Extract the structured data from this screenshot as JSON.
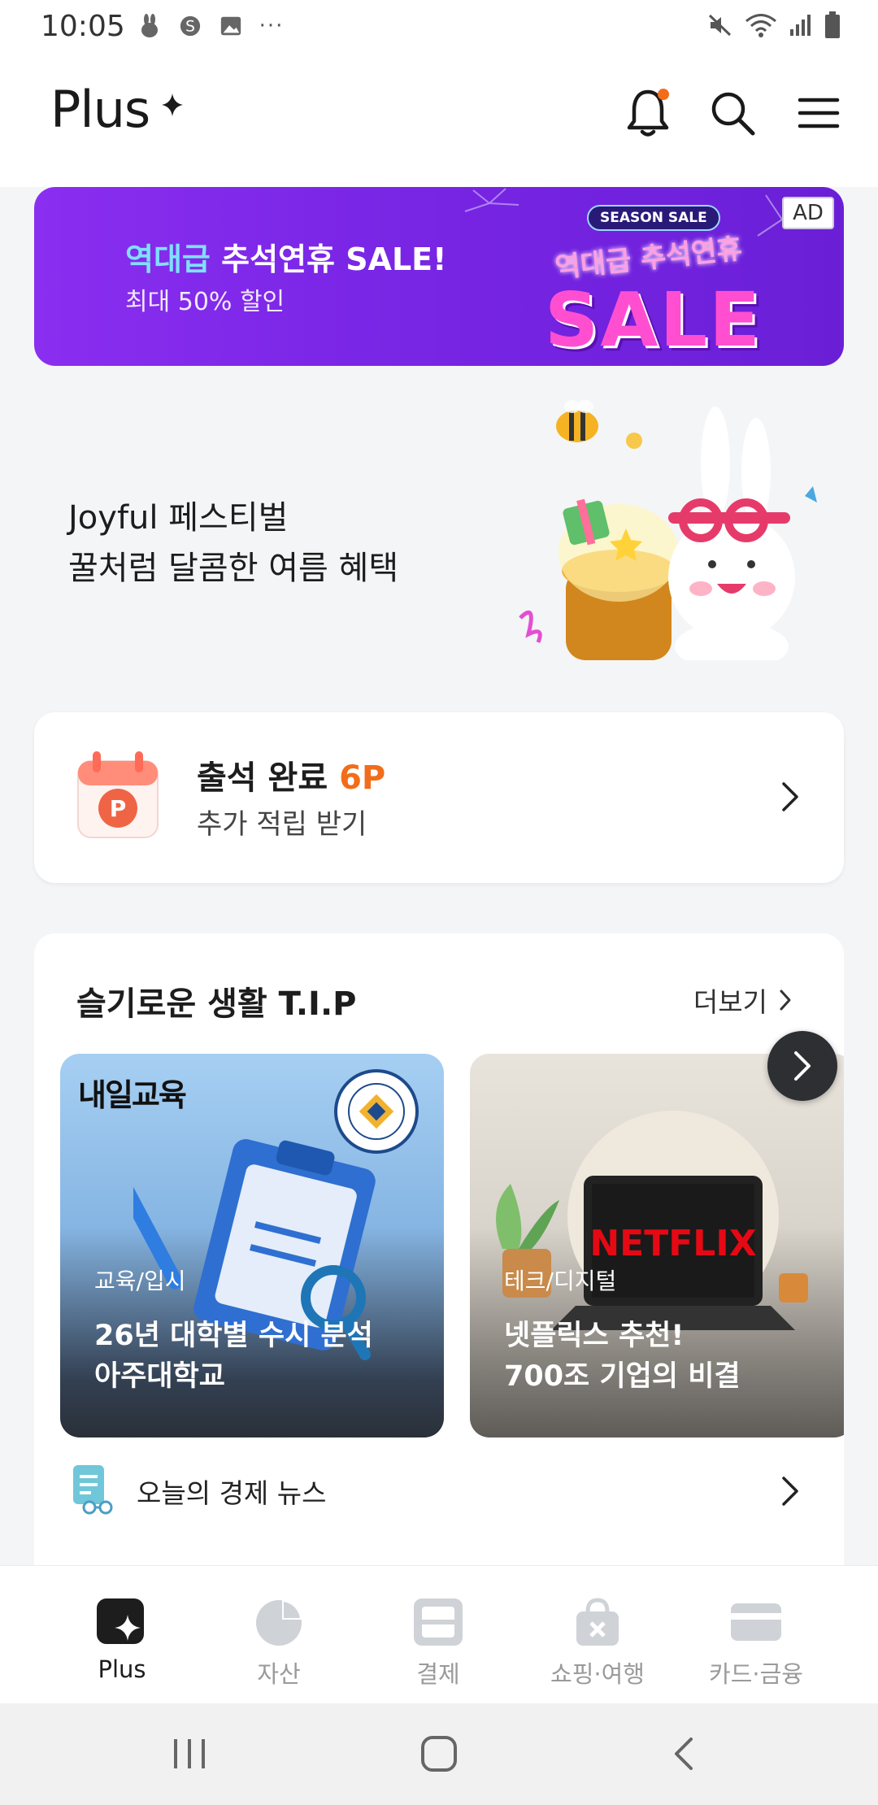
{
  "status_bar": {
    "time": "10:05",
    "left_icons": [
      "rabbit-icon",
      "s-icon",
      "image-icon",
      "more-dots-icon"
    ],
    "right_icons": [
      "mute-icon",
      "wifi-icon",
      "signal-icon",
      "battery-icon"
    ]
  },
  "header": {
    "logo": "Plus",
    "notification_dot_color": "#f26d1a"
  },
  "ad_banner": {
    "title_highlight": "역대급",
    "title_rest": " 추석연휴 SALE!",
    "subtitle": "최대 50% 할인",
    "badge": "AD",
    "season_label": "SEASON SALE",
    "art_top": "역대급 추석연휴",
    "art_big": "SALE"
  },
  "festival": {
    "line1": "Joyful 페스티벌",
    "line2": "꿀처럼 달콤한 여름 혜택"
  },
  "checkin": {
    "title": "출석 완료",
    "points": "6P",
    "subtitle": "추가 적립 받기",
    "icon_letter": "P"
  },
  "tips": {
    "title": "슬기로운 생활 T.I.P",
    "more": "더보기",
    "cards": [
      {
        "brand": "내일교육",
        "category": "교육/입시",
        "headline1": "26년 대학별 수시 분석",
        "headline2": "아주대학교"
      },
      {
        "brand": "NETFLIX",
        "category": "테크/디지털",
        "headline1": "넷플릭스 추천!",
        "headline2": "700조 기업의 비결"
      }
    ]
  },
  "news": {
    "label": "오늘의 경제 뉴스"
  },
  "bottom_nav": {
    "items": [
      {
        "label": "Plus",
        "active": true
      },
      {
        "label": "자산",
        "active": false
      },
      {
        "label": "결제",
        "active": false
      },
      {
        "label": "쇼핑·여행",
        "active": false
      },
      {
        "label": "카드·금융",
        "active": false
      }
    ]
  }
}
